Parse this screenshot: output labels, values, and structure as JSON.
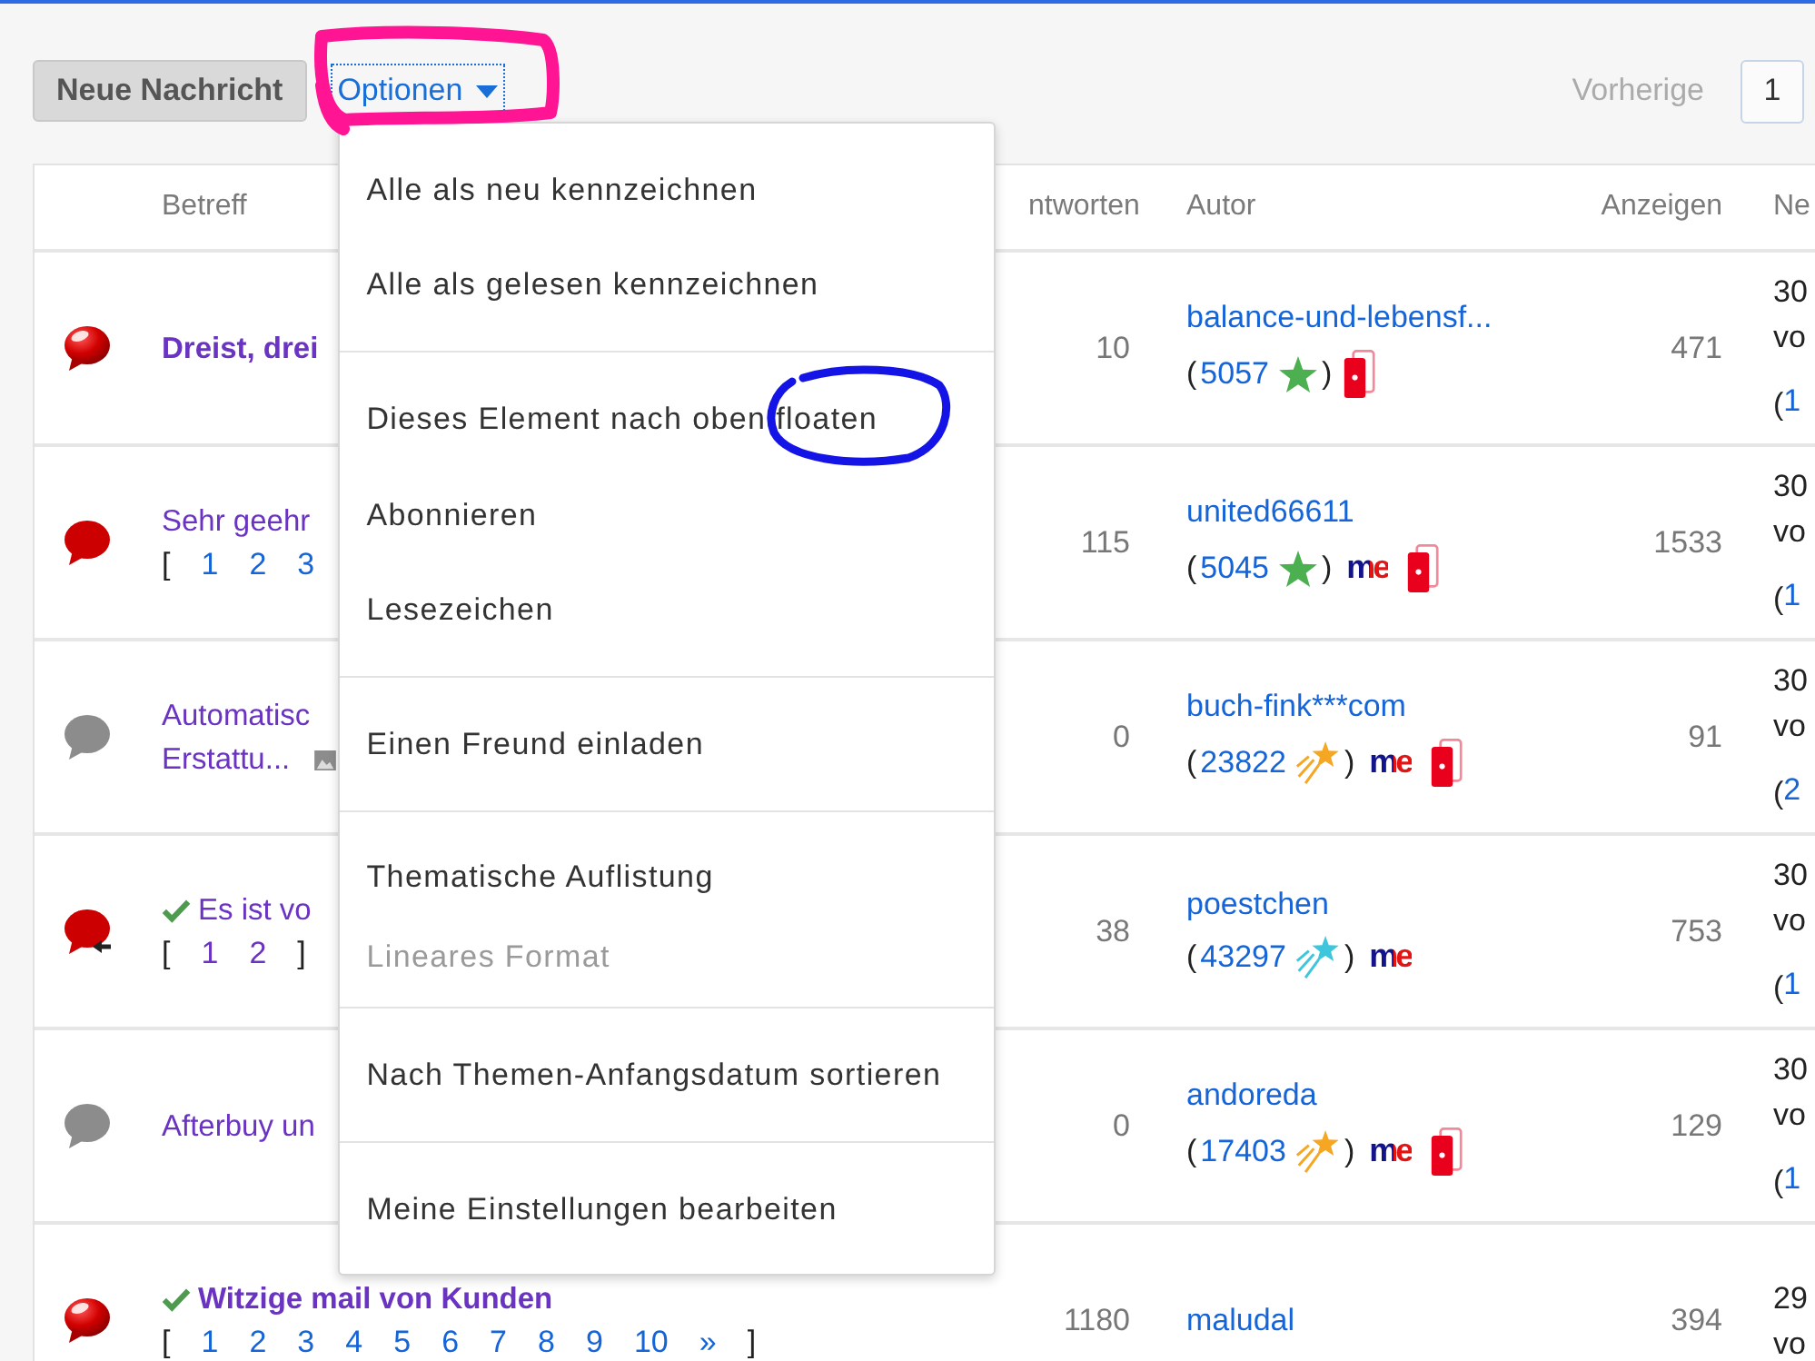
{
  "toolbar": {
    "new_message": "Neue Nachricht",
    "options": {
      "label": "Optionen",
      "expanded": true,
      "annotation": {
        "kind": "box",
        "color": "#ff1493"
      }
    },
    "previous": {
      "label": "Vorherige",
      "disabled": true
    },
    "page_field": {
      "value": "1"
    }
  },
  "menu": {
    "groups": [
      {
        "items": [
          {
            "label": "Alle als neu kennzeichnen",
            "disabled": false
          },
          {
            "label": "Alle als gelesen kennzeichnen",
            "disabled": false
          }
        ]
      },
      {
        "items": [
          {
            "label": "Dieses Element nach oben floaten",
            "disabled": false,
            "annotation": {
              "kind": "ellipse",
              "color": "#1414e6"
            }
          },
          {
            "label": "Abonnieren",
            "disabled": false
          },
          {
            "label": "Lesezeichen",
            "disabled": false
          }
        ]
      },
      {
        "items": [
          {
            "label": "Einen Freund einladen",
            "disabled": false
          }
        ]
      },
      {
        "items": [
          {
            "label": "Thematische Auflistung",
            "disabled": false
          },
          {
            "label": "Lineares Format",
            "disabled": true
          }
        ]
      },
      {
        "items": [
          {
            "label": "Nach Themen-Anfangsdatum sortieren",
            "disabled": false
          }
        ]
      },
      {
        "items": [
          {
            "label": "Meine Einstellungen bearbeiten",
            "disabled": false
          }
        ]
      }
    ]
  },
  "table": {
    "columns": [
      {
        "label": "Betreff"
      },
      {
        "label": "ntworten"
      },
      {
        "label": "Autor"
      },
      {
        "label": "Anzeigen"
      },
      {
        "label": "Ne"
      }
    ],
    "rows": [
      {
        "bubble": {
          "kind": "hot"
        },
        "solved": false,
        "unread": true,
        "subject": [
          "Dreist, drei"
        ],
        "has_image": false,
        "replies": "10",
        "author": {
          "name": "balance-und-lebensf...",
          "score_open": "(",
          "score": "5057",
          "rank": {
            "kind": "star",
            "color": "#4caf50"
          },
          "score_close": ")",
          "badges": [
            {
              "kind": "phone"
            }
          ]
        },
        "views": "471",
        "last": {
          "lines": [
            "30",
            "vo"
          ],
          "link_open": "(",
          "link": "1"
        }
      },
      {
        "bubble": {
          "kind": "new"
        },
        "solved": false,
        "unread": false,
        "subject": [
          "Sehr geehr"
        ],
        "has_image": false,
        "pages": {
          "open": "[",
          "links": [
            {
              "label": "1",
              "visited": false
            },
            {
              "label": "2",
              "visited": false
            },
            {
              "label": "3",
              "visited": false
            }
          ]
        },
        "replies": "115",
        "author": {
          "name": "united66611",
          "score_open": "(",
          "score": "5045",
          "rank": {
            "kind": "star",
            "color": "#4caf50"
          },
          "score_close": ")",
          "badges": [
            {
              "kind": "me",
              "text": "me"
            },
            {
              "kind": "phone"
            }
          ]
        },
        "views": "1533",
        "last": {
          "lines": [
            "30",
            "vo"
          ],
          "link_open": "(",
          "link": "1"
        }
      },
      {
        "bubble": {
          "kind": "read"
        },
        "solved": false,
        "unread": false,
        "subject": [
          "Automatisc",
          "Erstattu..."
        ],
        "has_image": true,
        "replies": "0",
        "author": {
          "name": "buch-fink***com",
          "score_open": "(",
          "score": "23822",
          "rank": {
            "kind": "shooting-star",
            "color": "#f5a623"
          },
          "score_close": ")",
          "badges": [
            {
              "kind": "me",
              "text": "me"
            },
            {
              "kind": "phone"
            }
          ]
        },
        "views": "91",
        "last": {
          "lines": [
            "30",
            "vo"
          ],
          "link_open": "(",
          "link": "2"
        }
      },
      {
        "bubble": {
          "kind": "moved"
        },
        "solved": true,
        "unread": false,
        "subject": [
          "Es ist vo"
        ],
        "has_image": false,
        "pages": {
          "open": "[",
          "links": [
            {
              "label": "1",
              "visited": true
            },
            {
              "label": "2",
              "visited": true
            }
          ],
          "close": "]"
        },
        "replies": "38",
        "author": {
          "name": "poestchen",
          "score_open": "(",
          "score": "43297",
          "rank": {
            "kind": "shooting-star",
            "color": "#3ec6dc"
          },
          "score_close": ")",
          "badges": [
            {
              "kind": "me",
              "text": "me"
            }
          ]
        },
        "views": "753",
        "last": {
          "lines": [
            "30",
            "vo"
          ],
          "link_open": "(",
          "link": "1"
        }
      },
      {
        "bubble": {
          "kind": "read"
        },
        "solved": false,
        "unread": false,
        "subject": [
          "Afterbuy un"
        ],
        "has_image": false,
        "replies": "0",
        "author": {
          "name": "andoreda",
          "score_open": "(",
          "score": "17403",
          "rank": {
            "kind": "shooting-star",
            "color": "#f5a623"
          },
          "score_close": ")",
          "badges": [
            {
              "kind": "me",
              "text": "me"
            },
            {
              "kind": "phone"
            }
          ]
        },
        "views": "129",
        "last": {
          "lines": [
            "30",
            "vo"
          ],
          "link_open": "(",
          "link": "1"
        }
      },
      {
        "bubble": {
          "kind": "hot"
        },
        "solved": true,
        "unread": true,
        "subject": [
          "Witzige mail von Kunden"
        ],
        "has_image": false,
        "pages": {
          "open": "[",
          "links": [
            {
              "label": "1",
              "visited": false
            },
            {
              "label": "2",
              "visited": false
            },
            {
              "label": "3",
              "visited": false
            },
            {
              "label": "4",
              "visited": false
            },
            {
              "label": "5",
              "visited": false
            },
            {
              "label": "6",
              "visited": false
            },
            {
              "label": "7",
              "visited": false
            },
            {
              "label": "8",
              "visited": false
            },
            {
              "label": "9",
              "visited": false
            },
            {
              "label": "10",
              "visited": false
            },
            {
              "label": "»",
              "visited": false
            }
          ],
          "close": "]"
        },
        "replies": "1180",
        "author": {
          "name": "maludal"
        },
        "views": "394",
        "last": {
          "lines": [
            "29",
            "vo"
          ]
        }
      }
    ]
  }
}
